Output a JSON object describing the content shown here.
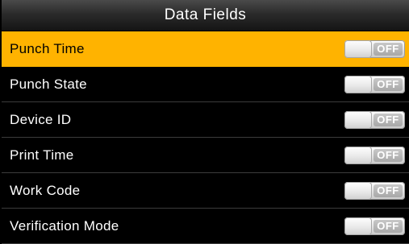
{
  "header": {
    "title": "Data Fields"
  },
  "fields": [
    {
      "label": "Punch Time",
      "toggle": "OFF",
      "selected": true
    },
    {
      "label": "Punch State",
      "toggle": "OFF",
      "selected": false
    },
    {
      "label": "Device ID",
      "toggle": "OFF",
      "selected": false
    },
    {
      "label": "Print Time",
      "toggle": "OFF",
      "selected": false
    },
    {
      "label": "Work Code",
      "toggle": "OFF",
      "selected": false
    },
    {
      "label": "Verification Mode",
      "toggle": "OFF",
      "selected": false
    }
  ],
  "colors": {
    "selected_row": "#ffb300",
    "background": "#000000",
    "divider": "#3c3c3c"
  }
}
